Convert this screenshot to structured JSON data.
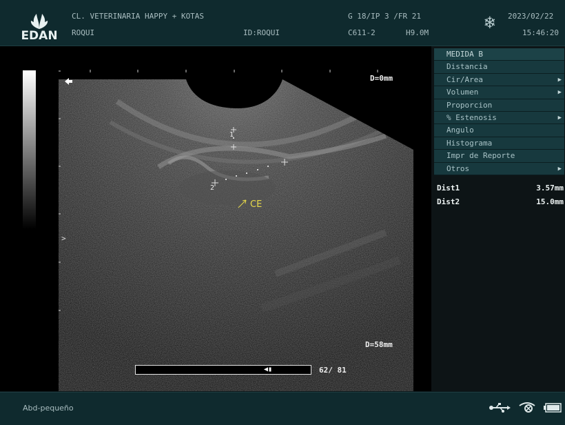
{
  "header": {
    "brand": "EDAN",
    "clinic": "CL. VETERINARIA HAPPY + KOTAS",
    "patient": "ROQUI",
    "patient_id": "ID:ROQUI",
    "params_line1": "G 18/IP 3 /FR 21",
    "probe": "C611-2",
    "freq": "H9.0M",
    "date": "2023/02/22",
    "time": "15:46:20",
    "freeze_icon": "snowflake-icon"
  },
  "image": {
    "depth_top": "D=0mm",
    "depth_bottom": "D=58mm",
    "annotation": "CE",
    "annotation_color": "#e6d84a",
    "caliper1_label": "1",
    "caliper2_label": "2",
    "cine_frame": "62/ 81",
    "focus_marker": ">"
  },
  "menu": {
    "title": "MEDIDA B",
    "items": [
      {
        "label": "Distancia",
        "arrow": ""
      },
      {
        "label": "Cir/Area",
        "arrow": "▶"
      },
      {
        "label": "Volumen",
        "arrow": "▶"
      },
      {
        "label": "Proporcion",
        "arrow": ""
      },
      {
        "label": "% Estenosis",
        "arrow": "▶"
      },
      {
        "label": "Angulo",
        "arrow": ""
      },
      {
        "label": "Histograma",
        "arrow": ""
      },
      {
        "label": "Impr de Reporte",
        "arrow": ""
      },
      {
        "label": "Otros",
        "arrow": "▶"
      }
    ]
  },
  "measurements": [
    {
      "label": "Dist1",
      "value": "3.57mm"
    },
    {
      "label": "Dist2",
      "value": "15.0mm"
    }
  ],
  "footer": {
    "preset": "Abd-pequeño",
    "usb_icon": "usb-icon",
    "network_icon": "network-icon",
    "battery_icon": "battery-icon"
  }
}
